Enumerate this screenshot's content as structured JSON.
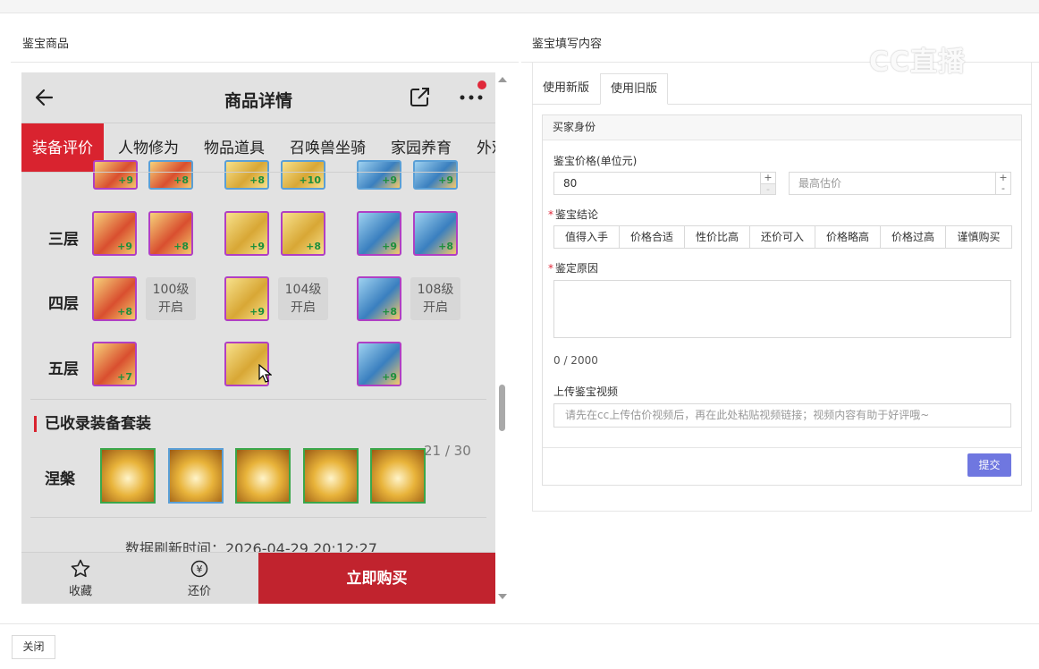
{
  "left_panel": {
    "title": "鉴宝商品",
    "phone": {
      "nav_title": "商品详情",
      "tabs": [
        "装备评价",
        "人物修为",
        "物品道具",
        "召唤兽坐骑",
        "家园养育",
        "外观"
      ],
      "rows": [
        {
          "label": "三层",
          "items": [
            "+9",
            "+8",
            "+9",
            "+8",
            "+9",
            "+8"
          ]
        },
        {
          "label": "四层",
          "items": [
            "+8",
            "+9",
            "+8"
          ],
          "locked": [
            [
              "100级",
              "开启"
            ],
            [
              "104级",
              "开启"
            ],
            [
              "108级",
              "开启"
            ]
          ]
        },
        {
          "label": "五层",
          "items": [
            "+7",
            "",
            "+9"
          ]
        },
        {
          "partial_items": [
            "+9",
            "+8",
            "+8",
            "+10",
            "+9",
            "+9"
          ]
        }
      ],
      "section_title": "已收录装备套装",
      "set_count": "21 / 30",
      "set_label": "涅槃",
      "refresh_text": "数据刷新时间：2026-04-29 20:12:27",
      "bottom": {
        "fav": "收藏",
        "bargain": "还价",
        "buy": "立即购买"
      }
    }
  },
  "right_panel": {
    "title": "鉴宝填写内容",
    "watermark": "CC直播",
    "tabs": [
      "使用新版",
      "使用旧版"
    ],
    "active_tab": "使用旧版",
    "form": {
      "header": "买家身份",
      "price_label": "鉴宝价格(单位元)",
      "price_value": "80",
      "max_placeholder": "最高估价",
      "conclusion_label": "鉴宝结论",
      "conclusions": [
        "值得入手",
        "价格合适",
        "性价比高",
        "还价可入",
        "价格略高",
        "价格过高",
        "谨慎购买"
      ],
      "reason_label": "鉴定原因",
      "counter": "0 / 2000",
      "video_label": "上传鉴宝视频",
      "video_placeholder": "请先在cc上传估价视频后，再在此处粘贴视频链接；视频内容有助于好评哦~",
      "submit": "提交"
    }
  },
  "footer": {
    "close": "关闭"
  }
}
